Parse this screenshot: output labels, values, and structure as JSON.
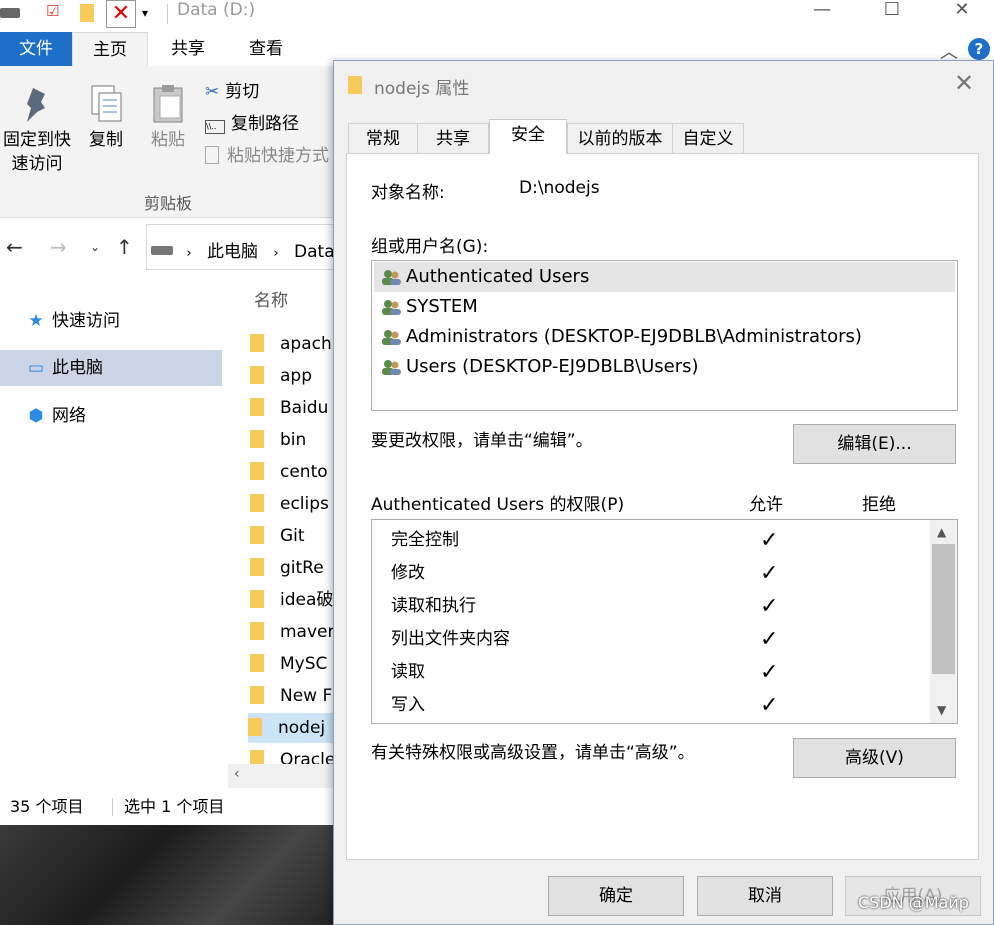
{
  "explorer": {
    "title": "Data (D:)",
    "tabs": {
      "file": "文件",
      "home": "主页",
      "share": "共享",
      "view": "查看"
    },
    "ribbon": {
      "pin_label_1": "固定到快",
      "pin_label_2": "速访问",
      "copy": "复制",
      "paste": "粘贴",
      "cut": "剪切",
      "copy_path": "复制路径",
      "paste_shortcut": "粘贴快捷方式",
      "group_clipboard": "剪贴板"
    },
    "address": {
      "this_pc": "此电脑",
      "data": "Data"
    },
    "nav": {
      "quick_access": "快速访问",
      "this_pc": "此电脑",
      "network": "网络"
    },
    "column_name": "名称",
    "files": [
      "apach",
      "app",
      "Baidu",
      "bin",
      "cento",
      "eclips",
      "Git",
      "gitRe",
      "idea破",
      "maver",
      "MySC",
      "New F",
      "nodej",
      "Oracle"
    ],
    "status": {
      "count": "35 个项目",
      "selected": "选中 1 个项目"
    }
  },
  "dialog": {
    "title": "nodejs 属性",
    "tabs": [
      "常规",
      "共享",
      "安全",
      "以前的版本",
      "自定义"
    ],
    "object_label": "对象名称:",
    "object_value": "D:\\nodejs",
    "groups_label": "组或用户名(G):",
    "users": [
      "Authenticated Users",
      "SYSTEM",
      "Administrators (DESKTOP-EJ9DBLB\\Administrators)",
      "Users (DESKTOP-EJ9DBLB\\Users)"
    ],
    "change_hint": "要更改权限，请单击“编辑”。",
    "edit_button": "编辑(E)...",
    "perm_label": "Authenticated Users 的权限(P)",
    "allow_header": "允许",
    "deny_header": "拒绝",
    "permissions": [
      {
        "name": "完全控制",
        "allow": "✓"
      },
      {
        "name": "修改",
        "allow": "✓"
      },
      {
        "name": "读取和执行",
        "allow": "✓"
      },
      {
        "name": "列出文件夹内容",
        "allow": "✓"
      },
      {
        "name": "读取",
        "allow": "✓"
      },
      {
        "name": "写入",
        "allow": "✓"
      }
    ],
    "advanced_hint": "有关特殊权限或高级设置，请单击“高级”。",
    "advanced_button": "高级(V)",
    "ok": "确定",
    "cancel": "取消",
    "apply": "应用(A)"
  },
  "watermark": "CSDN @Майр",
  "colors": {
    "accent": "#1e6fc8",
    "selection": "#ccd5e6",
    "folder": "#f6cb5b"
  }
}
